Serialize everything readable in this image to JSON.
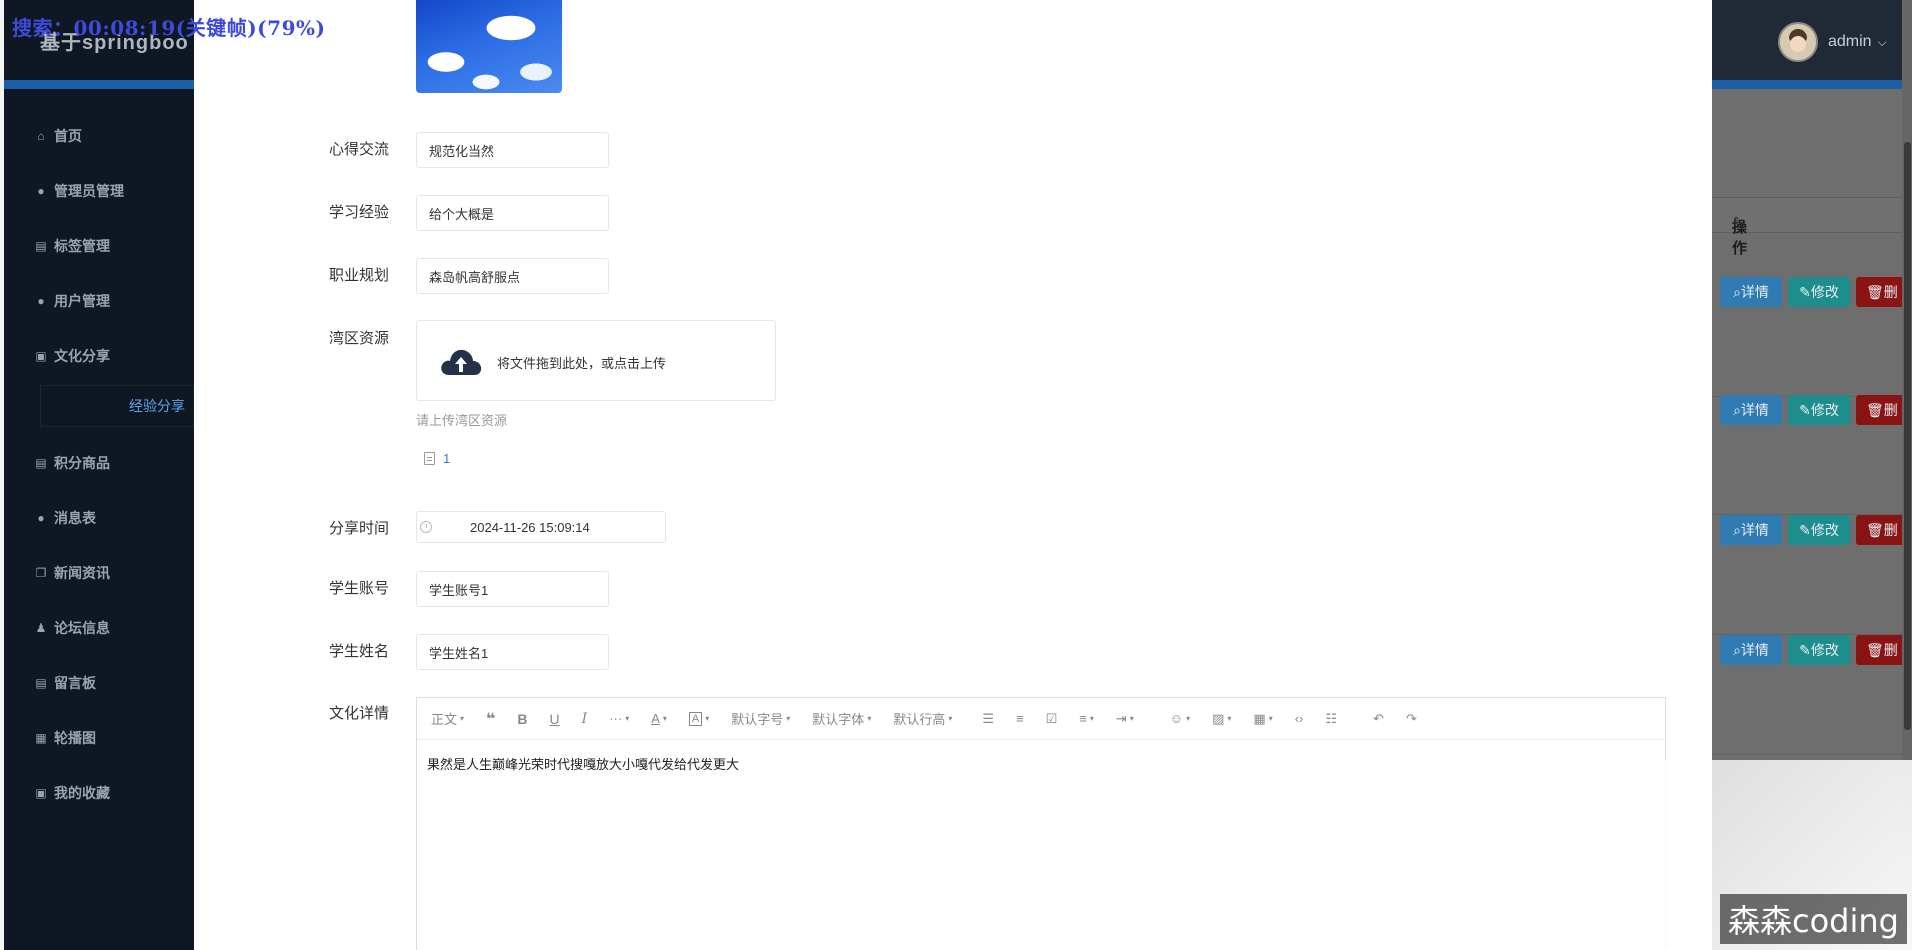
{
  "overlay": {
    "recording_text": "搜索：00:08:19(关键帧)(79%)",
    "watermark": "森森coding"
  },
  "app": {
    "brand": "基于springboo"
  },
  "user": {
    "name": "admin"
  },
  "sidebar": {
    "items": [
      {
        "label": "首页",
        "icon": "home-icon"
      },
      {
        "label": "管理员管理",
        "icon": "user-icon"
      },
      {
        "label": "标签管理",
        "icon": "table-icon"
      },
      {
        "label": "用户管理",
        "icon": "user-icon"
      },
      {
        "label": "文化分享",
        "icon": "briefcase-icon"
      },
      {
        "label": "经验分享",
        "sub": true
      },
      {
        "label": "积分商品",
        "icon": "table-icon"
      },
      {
        "label": "消息表",
        "icon": "circle-icon"
      },
      {
        "label": "新闻资讯",
        "icon": "copy-icon"
      },
      {
        "label": "论坛信息",
        "icon": "group-icon"
      },
      {
        "label": "留言板",
        "icon": "table-icon"
      },
      {
        "label": "轮播图",
        "icon": "grid-icon"
      },
      {
        "label": "我的收藏",
        "icon": "briefcase-icon"
      }
    ]
  },
  "table": {
    "op_header": "操作",
    "btn_detail": "详情",
    "btn_edit": "修改",
    "btn_delete": "删"
  },
  "form": {
    "xinde": {
      "label": "心得交流",
      "value": "规范化当然"
    },
    "jingyan": {
      "label": "学习经验",
      "value": "给个大概是"
    },
    "zhiye": {
      "label": "职业规划",
      "value": "森岛帆高舒服点"
    },
    "wanqu": {
      "label": "湾区资源",
      "upload_text": "将文件拖到此处，或点击上传",
      "hint": "请上传湾区资源",
      "file_name": "1"
    },
    "share_time": {
      "label": "分享时间",
      "value": "2024-11-26 15:09:14"
    },
    "account": {
      "label": "学生账号",
      "value": "学生账号1"
    },
    "name": {
      "label": "学生姓名",
      "value": "学生姓名1"
    },
    "detail": {
      "label": "文化详情",
      "content": "果然是人生巅峰光荣时代搜嘎放大小嘎代发给代发更大",
      "toolbar": {
        "paragraph": "正文",
        "quote": "❝",
        "bold": "B",
        "underline": "U",
        "italic": "I",
        "more": "···",
        "font_color": "A",
        "bg_color": "A",
        "font_size": "默认字号",
        "font_family": "默认字体",
        "line_height": "默认行高"
      }
    }
  }
}
